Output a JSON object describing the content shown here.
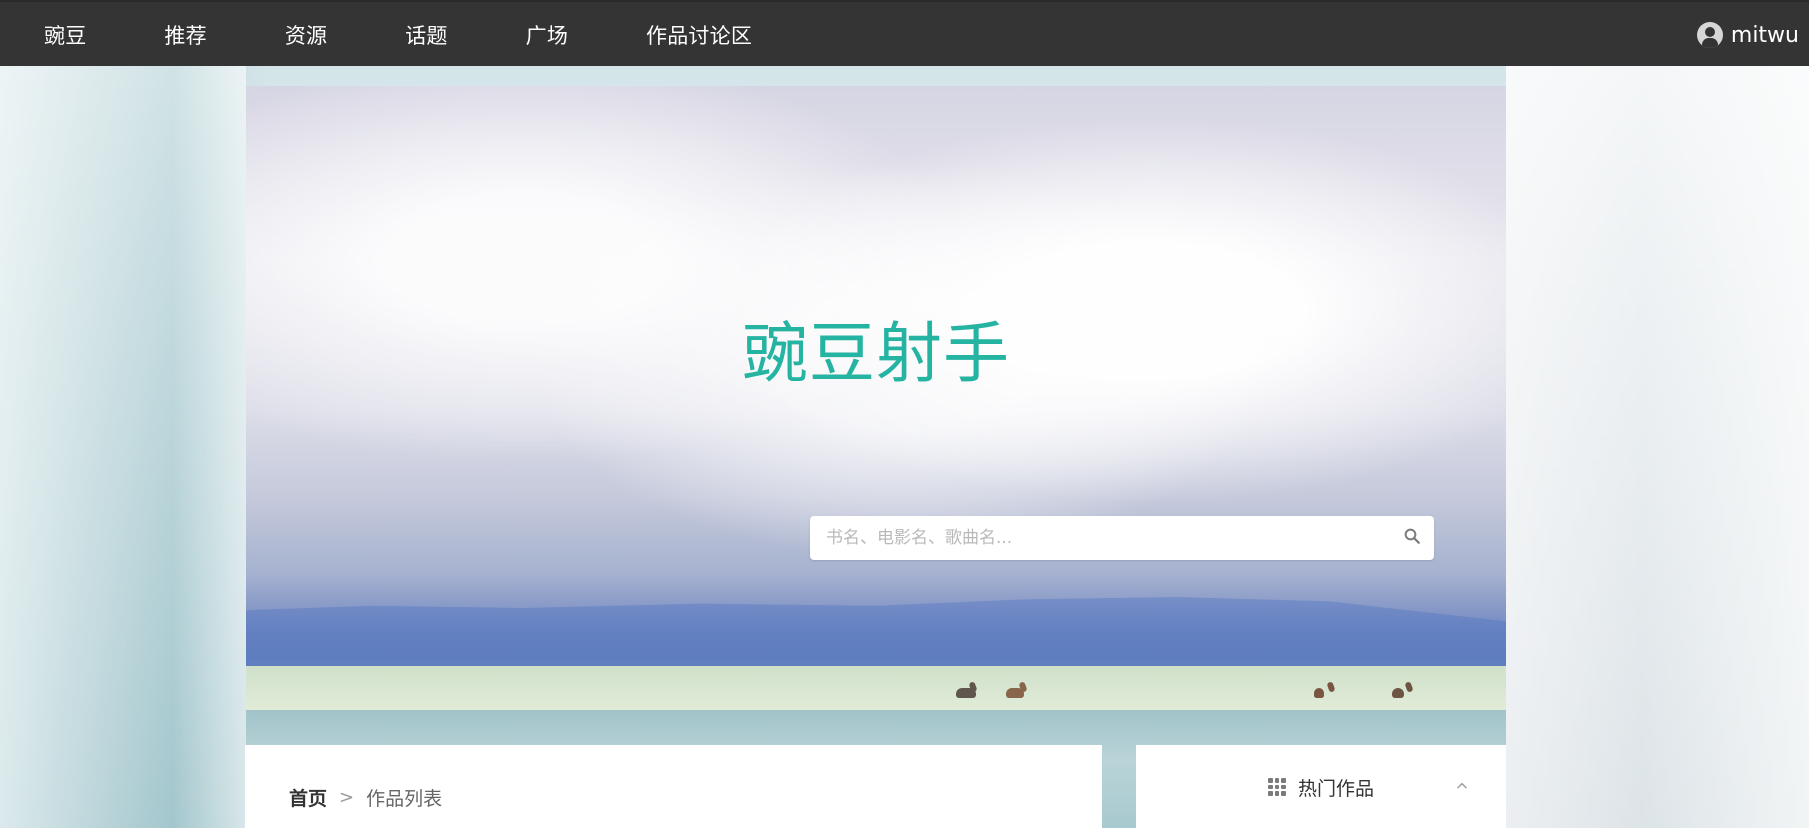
{
  "navbar": {
    "items": [
      "豌豆",
      "推荐",
      "资源",
      "话题",
      "广场",
      "作品讨论区"
    ],
    "user": {
      "name": "mitwu",
      "icon": "user-avatar-icon"
    },
    "colors": {
      "background": "#343434",
      "text": "#ffffff"
    }
  },
  "hero": {
    "title": "豌豆射手",
    "title_color": "#25b3a2",
    "search": {
      "placeholder": "书名、电影名、歌曲名...",
      "value": "",
      "icon": "search-icon"
    }
  },
  "content": {
    "breadcrumb": {
      "home": "首页",
      "separator": ">",
      "current": "作品列表"
    }
  },
  "sidebar": {
    "hot_works": {
      "title": "热门作品",
      "icon": "grid-icon",
      "toggle_icon": "chevron-up-icon"
    }
  }
}
